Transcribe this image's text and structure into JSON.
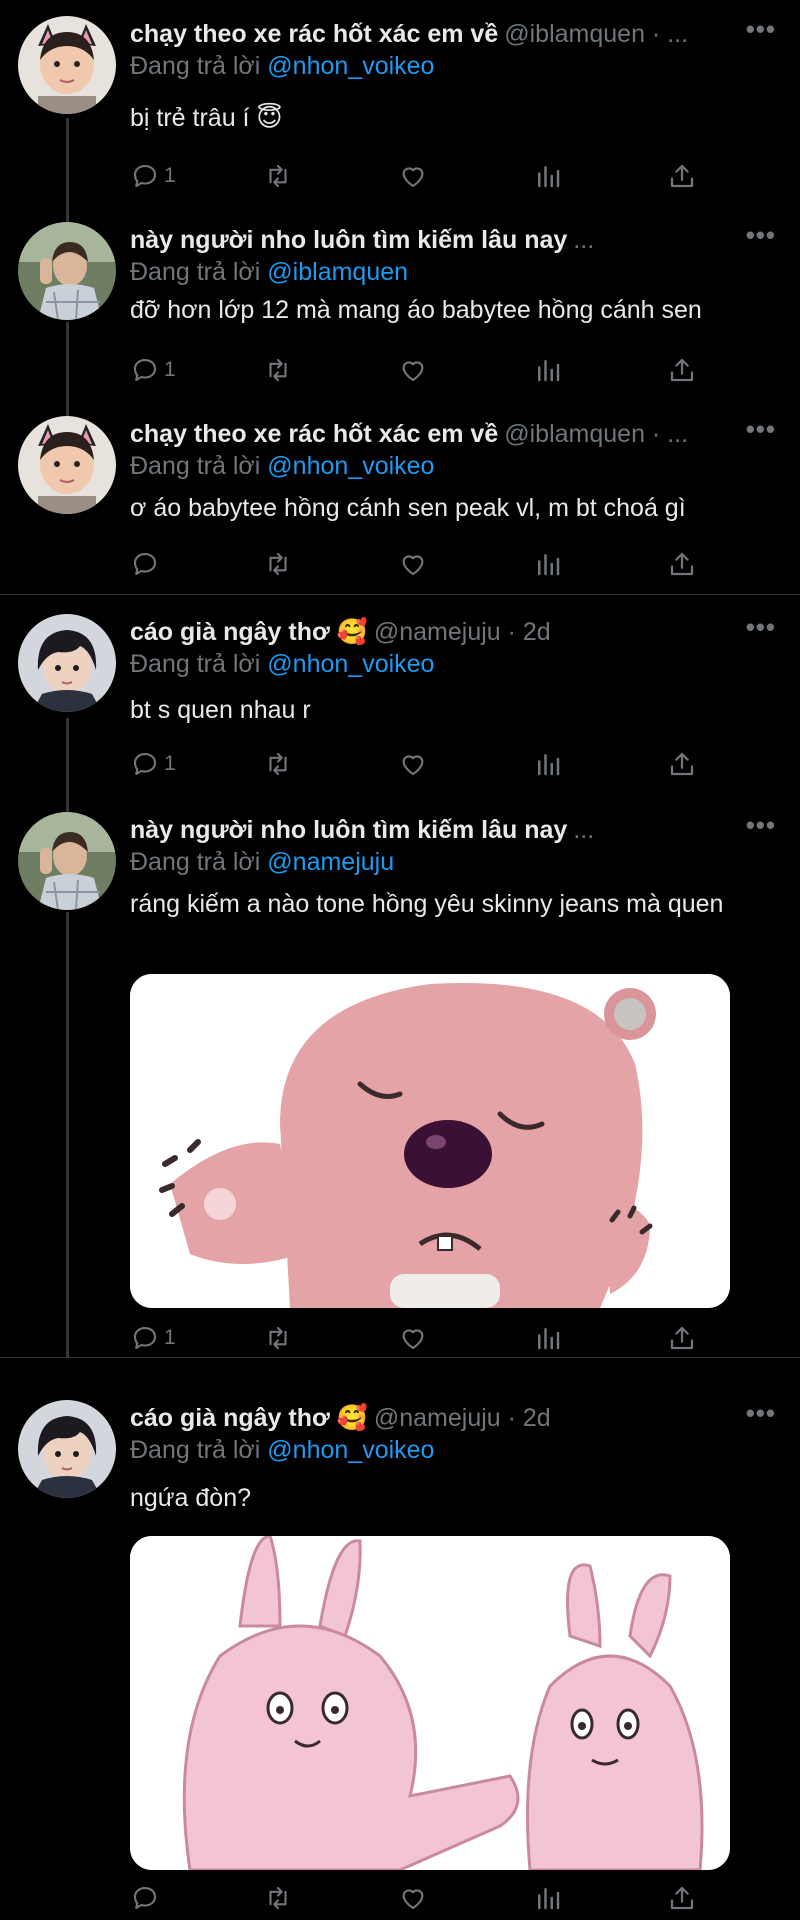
{
  "tweets": [
    {
      "name": "chạy theo xe rác hốt xác em về",
      "handle": "@iblamquen · ...",
      "reply_label": "Đang trả lời",
      "reply_to": "@nhon_voikeo",
      "text": "bị trẻ trâu í 😇",
      "reply_count": "1"
    },
    {
      "name": "này người nho luôn tìm kiếm lâu nay",
      "handle": "...",
      "reply_label": "Đang trả lời",
      "reply_to": "@iblamquen",
      "text": "đỡ hơn lớp 12 mà mang áo babytee hồng cánh sen",
      "reply_count": "1"
    },
    {
      "name": "chạy theo xe rác hốt xác em về",
      "handle": "@iblamquen · ...",
      "reply_label": "Đang trả lời",
      "reply_to": "@nhon_voikeo",
      "text": "ơ áo babytee hồng cánh sen peak vl, m bt choá gì",
      "reply_count": ""
    },
    {
      "name": "cáo già ngây thơ 🥰",
      "handle": "@namejuju · 2d",
      "reply_label": "Đang trả lời",
      "reply_to": "@nhon_voikeo",
      "text": "bt s quen nhau r",
      "reply_count": "1"
    },
    {
      "name": "này người nho luôn tìm kiếm lâu nay",
      "handle": "...",
      "reply_label": "Đang trả lời",
      "reply_to": "@namejuju",
      "text": "ráng kiếm a nào tone hồng yêu skinny jeans mà quen",
      "reply_count": "1"
    },
    {
      "name": "cáo già ngây thơ 🥰",
      "handle": "@namejuju · 2d",
      "reply_label": "Đang trả lời",
      "reply_to": "@nhon_voikeo",
      "text": "ngứa đòn?",
      "reply_count": ""
    }
  ],
  "more_label": "•••",
  "icons": [
    "reply-icon",
    "retweet-icon",
    "like-icon",
    "views-icon",
    "share-icon",
    "more-icon"
  ],
  "colors": {
    "background": "#000000",
    "text": "#e7e9ea",
    "muted": "#71767b",
    "mention": "#1d9bf0"
  }
}
